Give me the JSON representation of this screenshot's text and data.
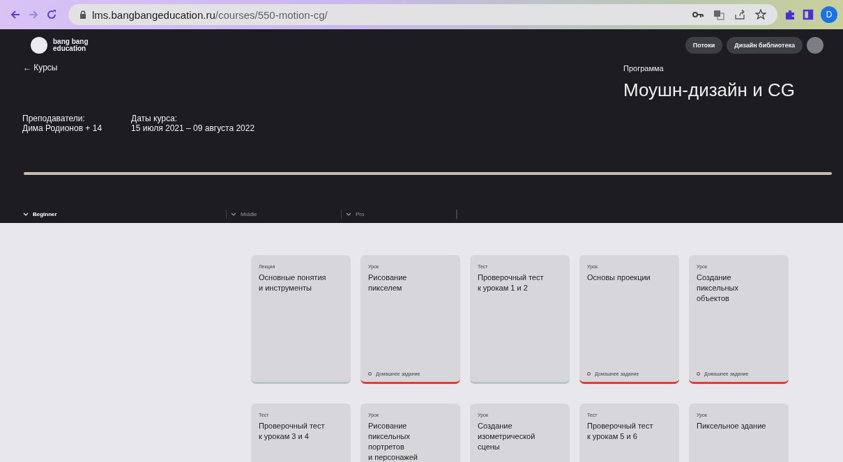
{
  "browser": {
    "url_host": "lms.bangbangeducation.ru",
    "url_path": "/courses/550-motion-cg/",
    "profile_initial": "D"
  },
  "header": {
    "logo_text": [
      "bang bang",
      "education"
    ],
    "nav_buttons": [
      "Потоки",
      "Дизайн библиотека"
    ],
    "back_link": "← Курсы",
    "program_label": "Программа",
    "course_title": "Моушн-дизайн и CG",
    "info": [
      {
        "label": "Преподаватели:",
        "value": "Дима Родионов + 14"
      },
      {
        "label": "Даты курса:",
        "value": "15 июля 2021 – 09 августа 2022"
      }
    ],
    "progress": {
      "level": 1
    },
    "levels": [
      {
        "label": "Beginner",
        "selected": true
      },
      {
        "label": "Middle",
        "selected": false
      },
      {
        "label": "Pro",
        "selected": false
      }
    ]
  },
  "cards": [
    {
      "kind": "Лекция",
      "title": "Основные понятия\nи инструменты",
      "color": "#b9c4c4"
    },
    {
      "kind": "Урок",
      "title": "Рисование\nпикселем",
      "homework": "Домашнее задание",
      "color": "#d8403c"
    },
    {
      "kind": "Тест",
      "title": "Проверочный тест\nк урокам 1 и 2",
      "color": "#b9c4c4"
    },
    {
      "kind": "Урок",
      "title": "Основы проекции",
      "homework": "Домашнее задание",
      "color": "#d8403c"
    },
    {
      "kind": "Урок",
      "title": "Создание\nпиксельных\nобъектов",
      "homework": "Домашнее задание",
      "color": "#d8403c"
    },
    {
      "kind": "Тест",
      "title": "Проверочный тест\nк урокам 3 и 4"
    },
    {
      "kind": "Урок",
      "title": "Рисование\nпиксельных\nпортретов\nи персонажей"
    },
    {
      "kind": "Урок",
      "title": "Создание\nизометрической\nсцены"
    },
    {
      "kind": "Тест",
      "title": "Проверочный тест\nк урокам 5 и 6"
    },
    {
      "kind": "Урок",
      "title": "Пиксельное здание"
    }
  ]
}
